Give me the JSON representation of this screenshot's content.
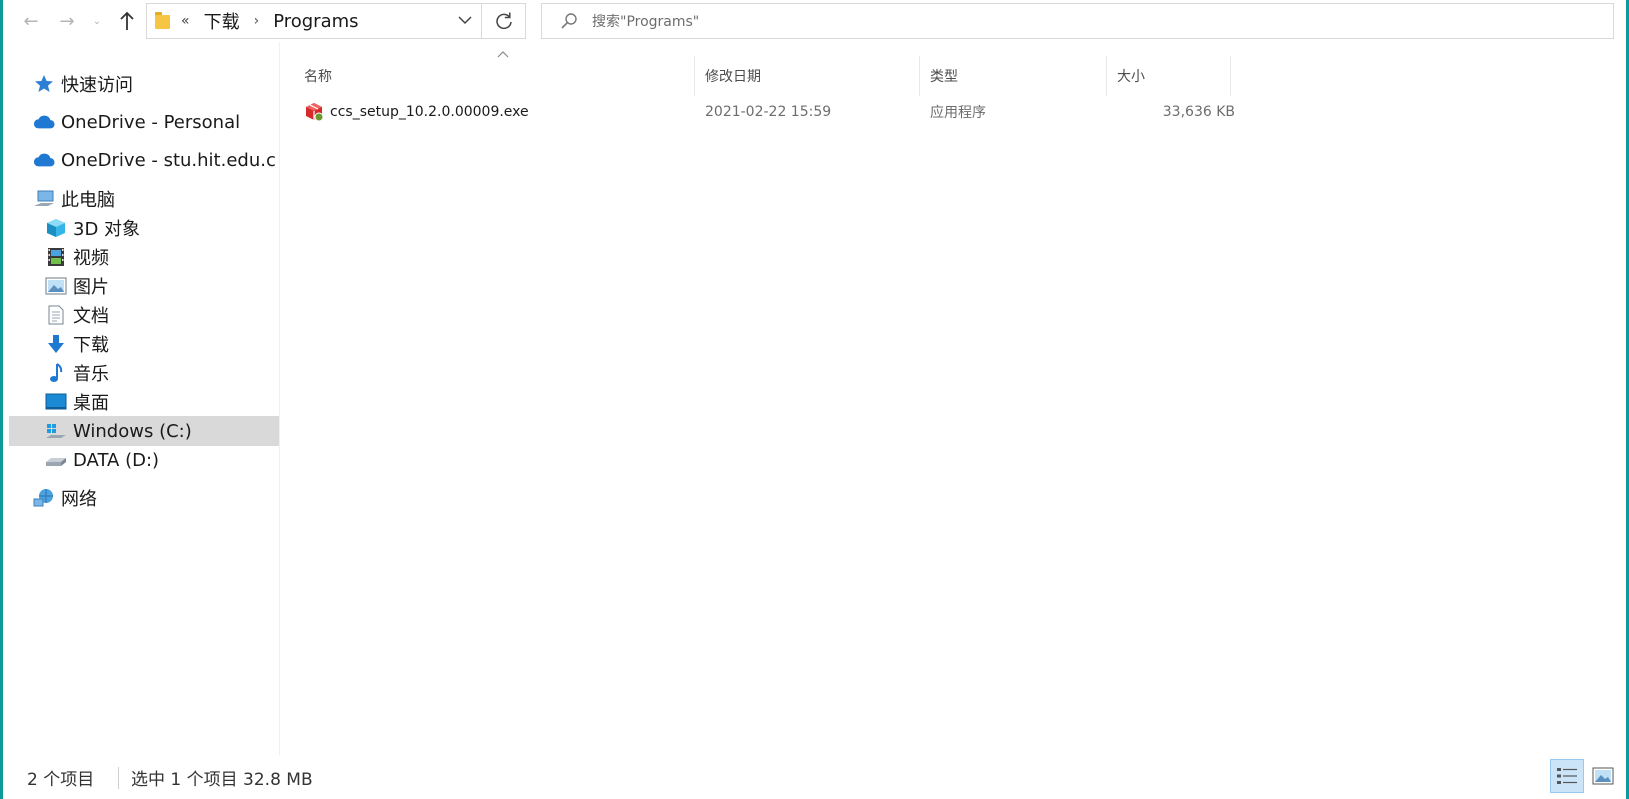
{
  "address": {
    "overflow": "«",
    "crumbs": [
      "下载",
      "Programs"
    ]
  },
  "search": {
    "placeholder": "搜索\"Programs\""
  },
  "nav": {
    "quick_access": "快速访问",
    "onedrive_personal": "OneDrive - Personal",
    "onedrive_school": "OneDrive - stu.hit.edu.c",
    "this_pc": "此电脑",
    "objects_3d": "3D 对象",
    "videos": "视频",
    "pictures": "图片",
    "documents": "文档",
    "downloads": "下载",
    "music": "音乐",
    "desktop": "桌面",
    "drive_c": "Windows (C:)",
    "drive_d": "DATA (D:)",
    "network": "网络"
  },
  "columns": {
    "name": "名称",
    "date": "修改日期",
    "type": "类型",
    "size": "大小"
  },
  "files": [
    {
      "name": "ccs_setup_10.2.0.00009.exe",
      "date": "2021-02-22 15:59",
      "type": "应用程序",
      "size": "33,636 KB",
      "icon": "installer-package-icon"
    }
  ],
  "status": {
    "count": "2 个项目",
    "selected": "选中 1 个项目  32.8 MB"
  },
  "colors": {
    "window_border": "#0f9a9a",
    "selected_nav": "#d9d9d9",
    "view_active": "#cce4f7"
  }
}
